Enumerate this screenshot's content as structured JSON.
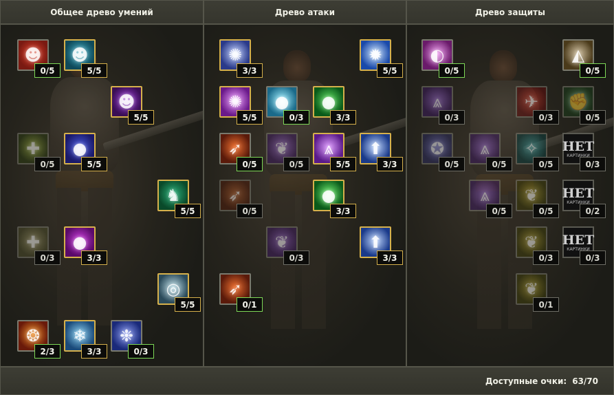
{
  "panels": [
    {
      "title": "Общее древо умений",
      "skills": [
        {
          "points": "0/5",
          "state": "part",
          "icon": "red-demon-icon",
          "glyph": "☻",
          "bg": "#7a1a12",
          "bg2": "#e0402a"
        },
        {
          "points": "5/5",
          "state": "full",
          "icon": "cyan-figure-icon",
          "glyph": "☻",
          "bg": "#0f4a5a",
          "bg2": "#3fb0c8"
        },
        {
          "points": "5/5",
          "state": "full",
          "icon": "purple-figure-icon",
          "glyph": "☻",
          "bg": "#3a0f55",
          "bg2": "#9a3ad8"
        },
        {
          "points": "0/5",
          "state": "none",
          "icon": "holy-cross-icon",
          "glyph": "✚",
          "bg": "#2a3a12",
          "bg2": "#9ab040"
        },
        {
          "points": "5/5",
          "state": "full",
          "icon": "blue-orbs-icon",
          "glyph": "●",
          "bg": "#1a1a6a",
          "bg2": "#4a5ae0"
        },
        {
          "points": "5/5",
          "state": "full",
          "icon": "shadow-figure-icon",
          "glyph": "♞",
          "bg": "#0a4a2a",
          "bg2": "#2ab07a"
        },
        {
          "points": "0/3",
          "state": "none",
          "icon": "red-cross-icon",
          "glyph": "✚",
          "bg": "#4a4a2a",
          "bg2": "#a09a6a"
        },
        {
          "points": "3/3",
          "state": "full",
          "icon": "magenta-orbs-icon",
          "glyph": "●",
          "bg": "#5a0a6a",
          "bg2": "#d040e0"
        },
        {
          "points": "5/5",
          "state": "full",
          "icon": "whirlwind-icon",
          "glyph": "◎",
          "bg": "#2a4a5a",
          "bg2": "#c0e0e8"
        },
        {
          "points": "2/3",
          "state": "part",
          "icon": "fire-crest-icon",
          "glyph": "❂",
          "bg": "#6a1a0a",
          "bg2": "#f0902a"
        },
        {
          "points": "3/3",
          "state": "full",
          "icon": "ice-crest-icon",
          "glyph": "❄",
          "bg": "#1a4a7a",
          "bg2": "#8ad0f0"
        },
        {
          "points": "0/3",
          "state": "part",
          "icon": "blue-spirit-icon",
          "glyph": "❉",
          "bg": "#1a2a7a",
          "bg2": "#8a9af0"
        }
      ]
    },
    {
      "title": "Древо атаки",
      "skills": [
        {
          "points": "3/3",
          "state": "full",
          "icon": "blue-sphere-icon",
          "glyph": "✺",
          "bg": "#2a3a8a",
          "bg2": "#c0d0ff"
        },
        {
          "points": "5/5",
          "state": "full",
          "icon": "ice-burst-icon",
          "glyph": "✹",
          "bg": "#1a4aaa",
          "bg2": "#d0e8ff"
        },
        {
          "points": "5/5",
          "state": "full",
          "icon": "arcane-circle-icon",
          "glyph": "✺",
          "bg": "#6a1a8a",
          "bg2": "#f0a0ff"
        },
        {
          "points": "0/3",
          "state": "part",
          "icon": "cyan-sphere-icon",
          "glyph": "●",
          "bg": "#1a6a8a",
          "bg2": "#a0f0ff"
        },
        {
          "points": "3/3",
          "state": "full",
          "icon": "green-sphere-icon",
          "glyph": "●",
          "bg": "#0a5a1a",
          "bg2": "#60e060"
        },
        {
          "points": "0/5",
          "state": "part",
          "icon": "flame-spear-icon",
          "glyph": "➶",
          "bg": "#5a1a0a",
          "bg2": "#f07030"
        },
        {
          "points": "0/5",
          "state": "none",
          "icon": "violet-wings-icon",
          "glyph": "❦",
          "bg": "#3a1a5a",
          "bg2": "#9a6ad0"
        },
        {
          "points": "5/5",
          "state": "full",
          "icon": "violet-rays-icon",
          "glyph": "⩓",
          "bg": "#5a1a8a",
          "bg2": "#e0a0ff"
        },
        {
          "points": "3/3",
          "state": "full",
          "icon": "blue-arrow-icon",
          "glyph": "⬆",
          "bg": "#1a3a8a",
          "bg2": "#c0d8ff"
        },
        {
          "points": "0/5",
          "state": "none",
          "icon": "flame-spear-dim-icon",
          "glyph": "➶",
          "bg": "#4a1a0a",
          "bg2": "#b05a2a"
        },
        {
          "points": "3/3",
          "state": "full",
          "icon": "green-orb-icon",
          "glyph": "●",
          "bg": "#0a5a1a",
          "bg2": "#70f070"
        },
        {
          "points": "0/3",
          "state": "none",
          "icon": "violet-wings-dim-icon",
          "glyph": "❦",
          "bg": "#3a1a5a",
          "bg2": "#8a5ac0"
        },
        {
          "points": "3/3",
          "state": "full",
          "icon": "blue-arrow-2-icon",
          "glyph": "⬆",
          "bg": "#1a3a8a",
          "bg2": "#c0d8ff"
        },
        {
          "points": "0/1",
          "state": "part",
          "icon": "flame-spear-2-icon",
          "glyph": "➶",
          "bg": "#5a1a0a",
          "bg2": "#f07030"
        }
      ]
    },
    {
      "title": "Древо защиты",
      "skills": [
        {
          "points": "0/5",
          "state": "part",
          "icon": "pink-shield-icon",
          "glyph": "◐",
          "bg": "#6a1a6a",
          "bg2": "#f0a0f0"
        },
        {
          "points": "0/5",
          "state": "part",
          "icon": "boots-icon",
          "glyph": "◭",
          "bg": "#4a3a1a",
          "bg2": "#d0c0a0"
        },
        {
          "points": "0/3",
          "state": "none",
          "icon": "violet-rune-icon",
          "glyph": "⩓",
          "bg": "#3a1a5a",
          "bg2": "#9a6ad0"
        },
        {
          "points": "0/3",
          "state": "none",
          "icon": "eagle-icon",
          "glyph": "✈",
          "bg": "#5a0a0a",
          "bg2": "#d04030"
        },
        {
          "points": "0/5",
          "state": "none",
          "icon": "chain-fist-icon",
          "glyph": "✊",
          "bg": "#1a3a1a",
          "bg2": "#60a060"
        },
        {
          "points": "0/5",
          "state": "none",
          "icon": "violet-seal-icon",
          "glyph": "✪",
          "bg": "#2a2a5a",
          "bg2": "#7a7ad0"
        },
        {
          "points": "0/5",
          "state": "none",
          "icon": "violet-crest-icon",
          "glyph": "⩓",
          "bg": "#3a1a5a",
          "bg2": "#9a6ad0"
        },
        {
          "points": "0/5",
          "state": "none",
          "icon": "teal-crystal-icon",
          "glyph": "✧",
          "bg": "#0a3a3a",
          "bg2": "#40a0a0"
        },
        {
          "points": "0/3",
          "state": "none",
          "icon": "no-image-icon",
          "noimg": true
        },
        {
          "points": "0/5",
          "state": "none",
          "icon": "violet-crest-2-icon",
          "glyph": "⩓",
          "bg": "#3a1a5a",
          "bg2": "#9a6ad0"
        },
        {
          "points": "0/5",
          "state": "none",
          "icon": "golden-tree-icon",
          "glyph": "❦",
          "bg": "#3a3a0a",
          "bg2": "#b0a030"
        },
        {
          "points": "0/2",
          "state": "none",
          "icon": "no-image-2-icon",
          "noimg": true
        },
        {
          "points": "0/3",
          "state": "none",
          "icon": "golden-tree-2-icon",
          "glyph": "❦",
          "bg": "#3a3a0a",
          "bg2": "#b0a030"
        },
        {
          "points": "0/3",
          "state": "none",
          "icon": "no-image-3-icon",
          "noimg": true
        },
        {
          "points": "0/1",
          "state": "none",
          "icon": "golden-tree-3-icon",
          "glyph": "❦",
          "bg": "#3a3a0a",
          "bg2": "#b0a030"
        }
      ]
    }
  ],
  "noimage": {
    "big": "НЕТ",
    "small": "КАРТИНКИ"
  },
  "footer": {
    "label": "Доступные очки:",
    "value": "63/70"
  }
}
